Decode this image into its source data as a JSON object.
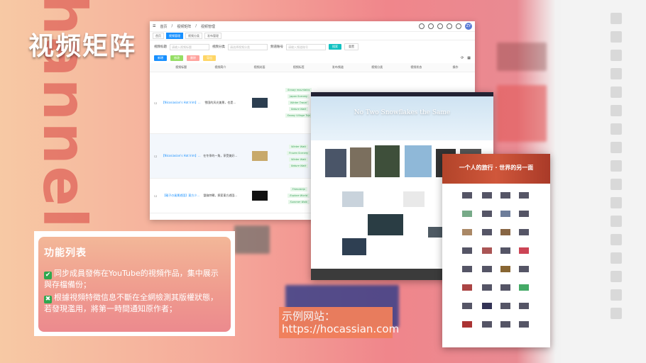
{
  "page": {
    "title": "视频矩阵",
    "background_word": "hannel"
  },
  "admin": {
    "breadcrumb": [
      "首页",
      "视频矩阵",
      "视频管理"
    ],
    "user_initials": "ZY",
    "tabs": [
      "首页",
      "视频管理",
      "视频分类",
      "发布管理"
    ],
    "filters": [
      {
        "label": "视频标题",
        "placeholder": "请输入视频标题"
      },
      {
        "label": "视频分类",
        "placeholder": "请选择视频分类"
      },
      {
        "label": "频道账号",
        "placeholder": "请输入频道账号"
      }
    ],
    "search_label": "搜索",
    "reset_label": "重置",
    "actions": [
      {
        "label": "新增",
        "color": "#1890ff"
      },
      {
        "label": "修改",
        "color": "#52c41a"
      },
      {
        "label": "删除",
        "color": "#ff7875"
      },
      {
        "label": "导出",
        "color": "#faad14"
      }
    ],
    "columns": [
      "视频标题",
      "视频简介",
      "视频封面",
      "视频标签",
      "发布频道",
      "视频分类",
      "视频状态",
      "操作"
    ],
    "rows": [
      {
        "title": "【Nicosiasian's Hat Irim】...",
        "intro": "雪国的风光美景，也是...",
        "tags": [
          "Snowy mountains",
          "Japan Scenery",
          "Winter Travel",
          "Nature Walk",
          "Snowy Village Trip"
        ]
      },
      {
        "title": "【Nicosiasian's Hat Irim】...",
        "intro": "在冬季的一角，享受美好...",
        "tags": [
          "Winter Walk",
          "Frozen Scenery",
          "Winter Walk",
          "Nature Walk"
        ]
      },
      {
        "title": "【親子の風景遊園】東方少...",
        "intro": "冒險特輯，探索東方遊園...",
        "tags": [
          "Friendship",
          "Explore World",
          "Summer Walk"
        ]
      }
    ]
  },
  "site1": {
    "hero_title": "No Two Snowflakes the Same"
  },
  "site2": {
    "hero_title": "一个人的旅行 · 世界的另一面"
  },
  "features": {
    "title": "功能列表",
    "items": [
      "同步成員發佈在YouTube的視頻作品，集中展示與存檔備份；",
      "根據視頻特徵信息不斷在全網檢測其版權狀態，若發現濫用，將第一時間通知原作者；"
    ],
    "item_icons": [
      "check-icon",
      "cross-icon"
    ]
  },
  "demo": {
    "label": "示例网站：",
    "url": "https://hocassian.com"
  }
}
